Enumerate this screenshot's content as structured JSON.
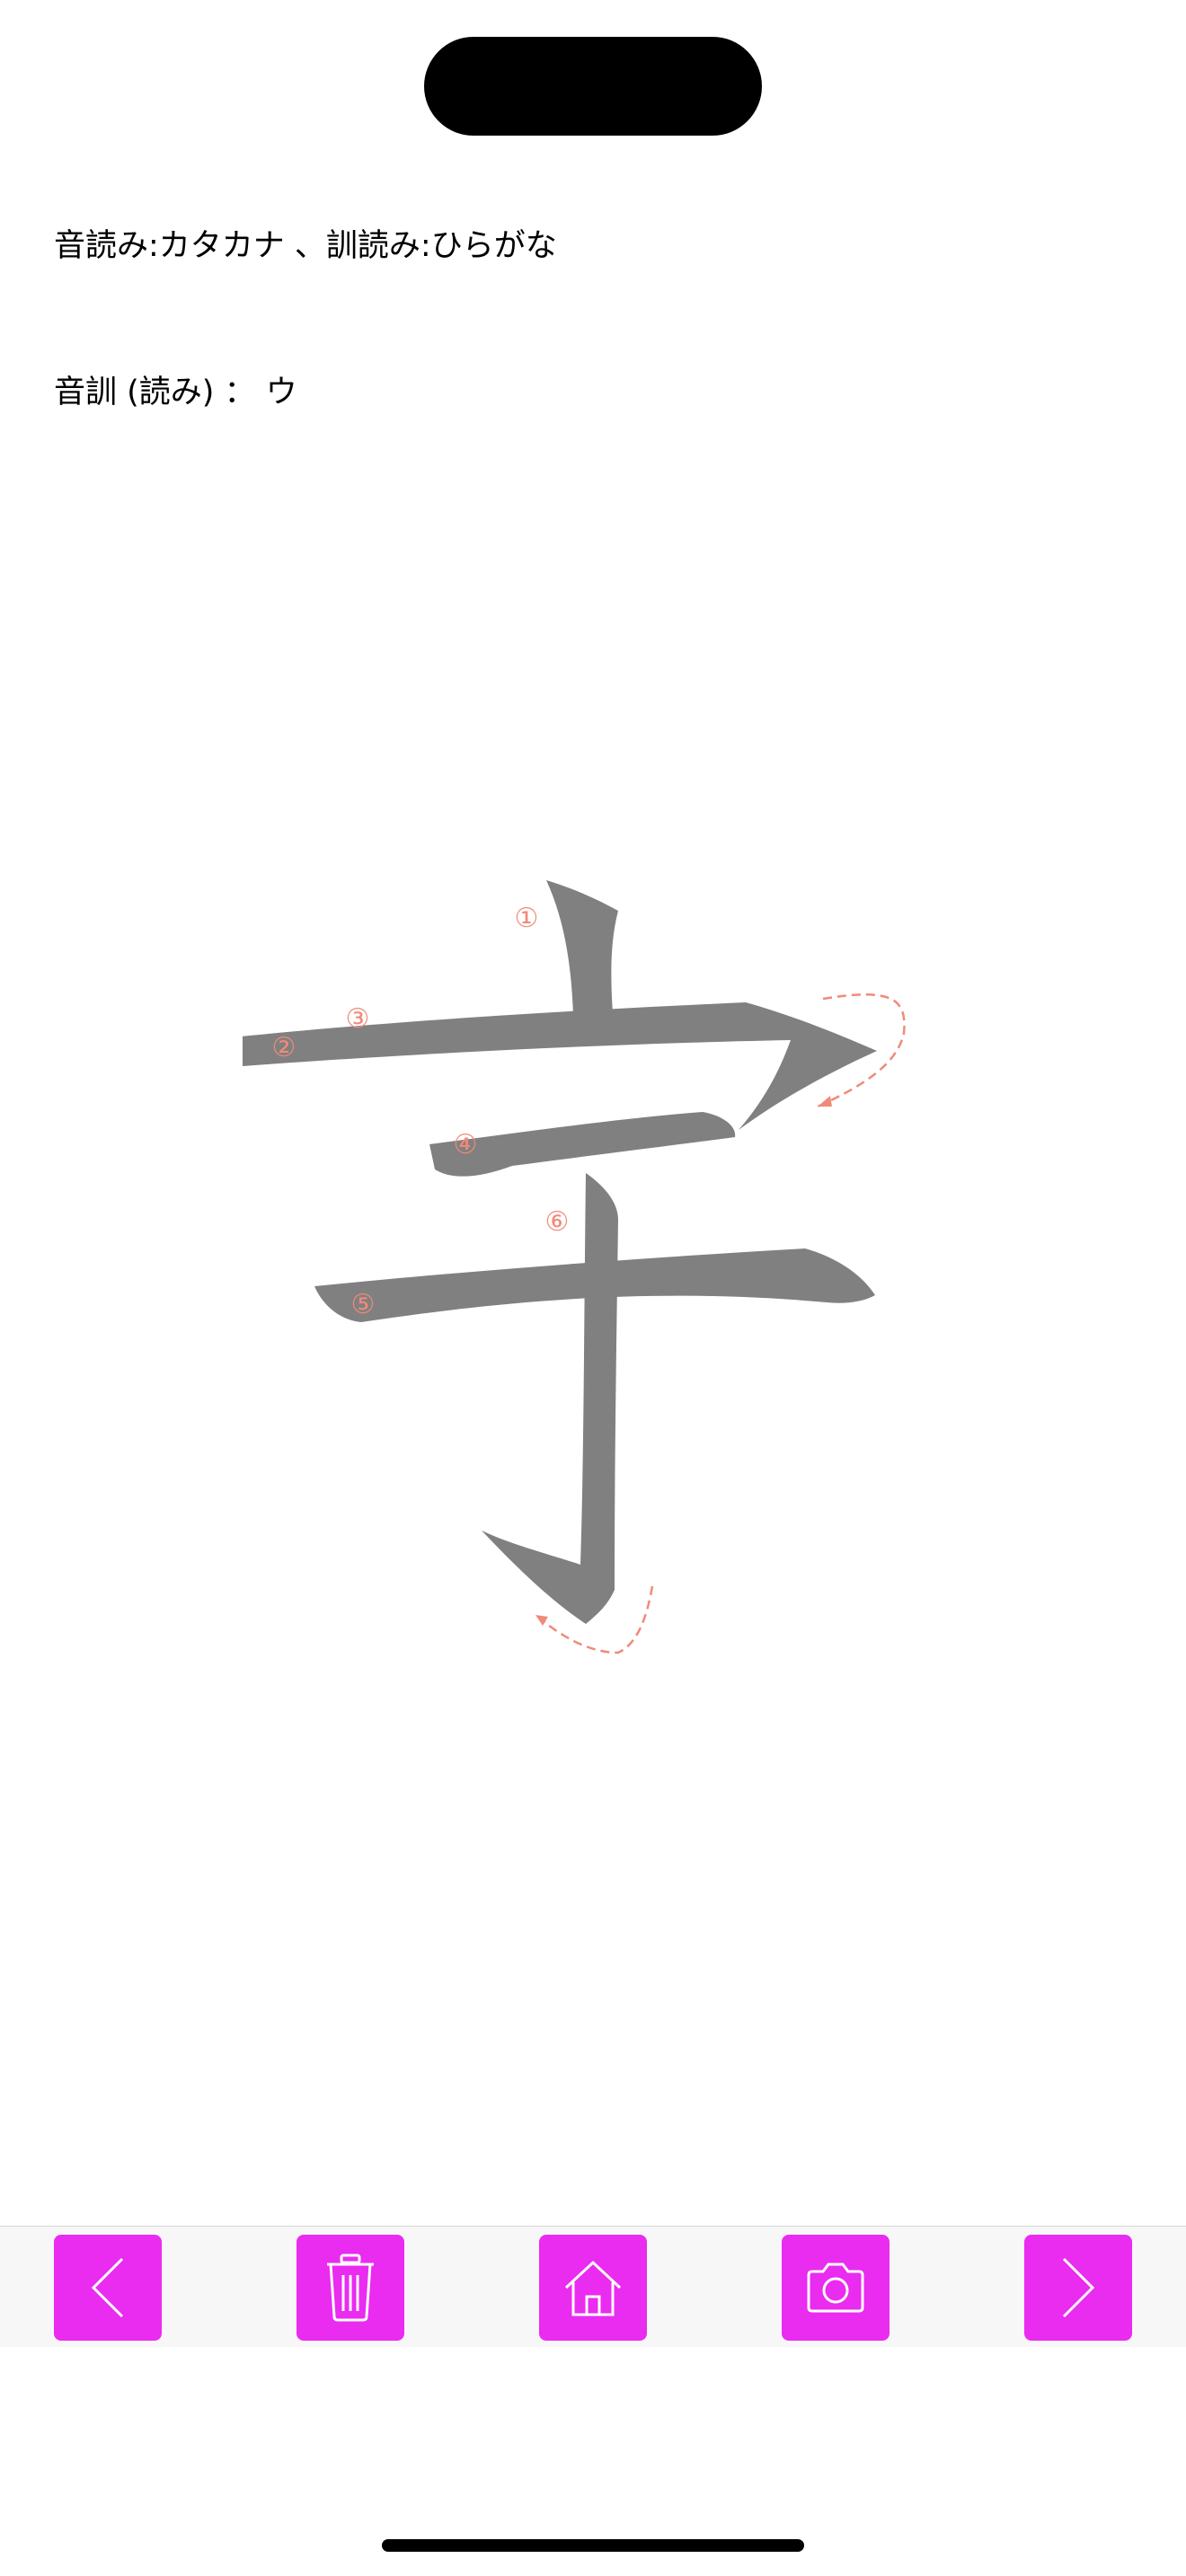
{
  "legend": "音読み:カタカナ 、訓読み:ひらがな",
  "reading": {
    "label": "音訓 (読み) ：",
    "value": "ウ"
  },
  "kanji": {
    "character": "宇",
    "stroke_count": 6,
    "stroke_numbers": [
      "①",
      "②",
      "③",
      "④",
      "⑤",
      "⑥"
    ],
    "stroke_color": "#808080",
    "guide_color": "#f08a7a"
  },
  "toolbar": {
    "accent": "#ea2bf0",
    "buttons": [
      {
        "name": "back",
        "icon": "chevron-left-icon"
      },
      {
        "name": "delete",
        "icon": "trash-icon"
      },
      {
        "name": "home",
        "icon": "home-icon"
      },
      {
        "name": "camera",
        "icon": "camera-icon"
      },
      {
        "name": "next",
        "icon": "chevron-right-icon"
      }
    ]
  }
}
